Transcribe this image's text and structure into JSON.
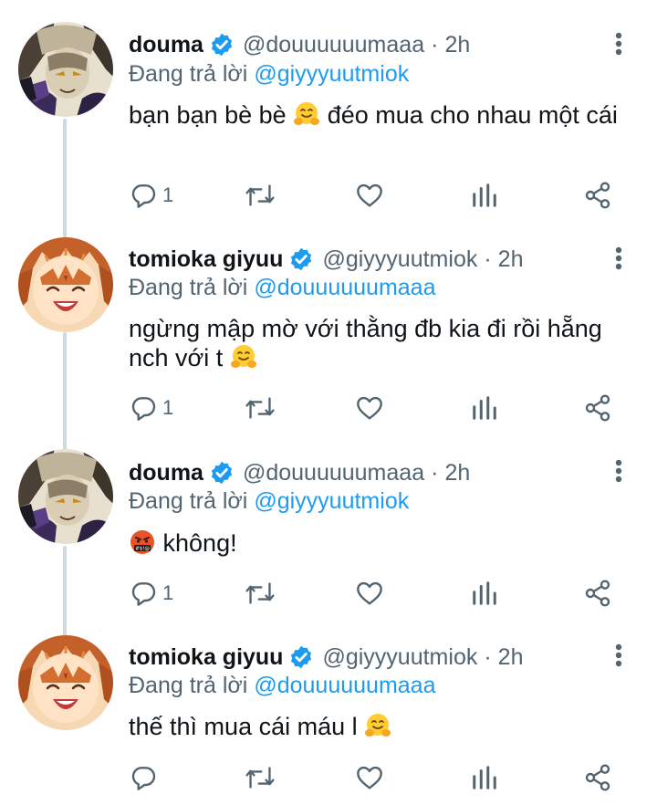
{
  "tweets": [
    {
      "display_name": "douma",
      "handle": "@douuuuuumaaa",
      "separator": "·",
      "time": "2h",
      "reply_prefix": "Đang trả lời",
      "reply_to": "@giyyyuutmiok",
      "text_before_emoji": "bạn bạn bè bè",
      "text_after_emoji": "đéo mua cho nhau một cái",
      "emoji": "hugging-face",
      "reply_count": "1",
      "avatar": "douma"
    },
    {
      "display_name": "tomioka giyuu",
      "handle": "@giyyyuutmiok",
      "separator": "·",
      "time": "2h",
      "reply_prefix": "Đang trả lời",
      "reply_to": "@douuuuuumaaa",
      "text_before_emoji": "ngừng mập mờ với thằng đb kia đi rồi hẵng nch với t",
      "text_after_emoji": "",
      "emoji": "hugging-face",
      "reply_count": "1",
      "avatar": "giyuu"
    },
    {
      "display_name": "douma",
      "handle": "@douuuuuumaaa",
      "separator": "·",
      "time": "2h",
      "reply_prefix": "Đang trả lời",
      "reply_to": "@giyyyuutmiok",
      "text_before_emoji": "",
      "text_after_emoji": "không!",
      "emoji": "cursing-face",
      "reply_count": "1",
      "avatar": "douma"
    },
    {
      "display_name": "tomioka giyuu",
      "handle": "@giyyyuutmiok",
      "separator": "·",
      "time": "2h",
      "reply_prefix": "Đang trả lời",
      "reply_to": "@douuuuuumaaa",
      "text_before_emoji": "thế thì mua cái máu l",
      "text_after_emoji": "",
      "emoji": "hugging-face",
      "reply_count": "",
      "avatar": "giyuu"
    }
  ],
  "colors": {
    "text": "#0f1419",
    "secondary": "#536471",
    "link": "#1d9bf0",
    "verified": "#1d9bf0",
    "thread_line": "#cfd9de"
  },
  "icons": {
    "verified": "verified-badge-icon",
    "more": "more-vertical-icon",
    "reply": "reply-icon",
    "retweet": "retweet-icon",
    "like": "heart-icon",
    "views": "analytics-icon",
    "share": "share-icon"
  }
}
